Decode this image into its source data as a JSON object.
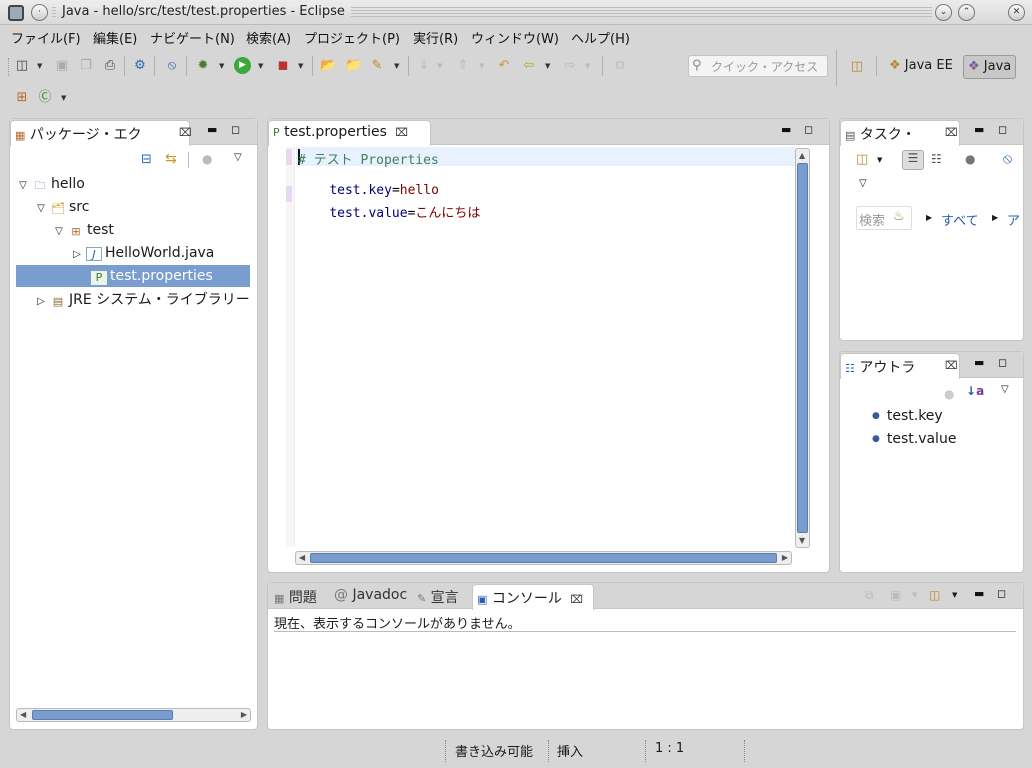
{
  "window": {
    "title": "Java - hello/src/test/test.properties - Eclipse"
  },
  "menu": [
    "ファイル(F)",
    "編集(E)",
    "ナビゲート(N)",
    "検索(A)",
    "プロジェクト(P)",
    "実行(R)",
    "ウィンドウ(W)",
    "ヘルプ(H)"
  ],
  "toolbar": {
    "search_placeholder": "クイック・アクセス"
  },
  "perspectives": {
    "java_ee": "Java EE",
    "java": "Java"
  },
  "package_explorer": {
    "title": "パッケージ・エク",
    "tree": {
      "project": "hello",
      "src": "src",
      "package": "test",
      "java_file": "HelloWorld.java",
      "properties_file": "test.properties",
      "jre": "JRE システム・ライブラリー ["
    }
  },
  "editor": {
    "tab": "test.properties",
    "lines": {
      "comment": "# テスト Properties",
      "key1": "test.key",
      "eq1": "=",
      "val1": "hello",
      "key2": "test.value",
      "eq2": "=",
      "val2": "こんにちは"
    }
  },
  "task_list": {
    "title": "タスク・",
    "search": "検索",
    "all": "すべて",
    "more": "ア"
  },
  "outline": {
    "title": "アウトラ",
    "items": [
      "test.key",
      "test.value"
    ]
  },
  "bottom": {
    "tabs": {
      "problems": "問題",
      "javadoc": "Javadoc",
      "declaration": "宣言",
      "console": "コンソール"
    },
    "console_message": "現在、表示するコンソールがありません。"
  },
  "status": {
    "writable": "書き込み可能",
    "insert_mode": "挿入",
    "position": "1 : 1"
  },
  "colors": {
    "selection": "#7a9dd0",
    "comment": "#3f7f5f",
    "key": "#00007f",
    "value": "#7f0000",
    "link": "#2a5db0"
  }
}
